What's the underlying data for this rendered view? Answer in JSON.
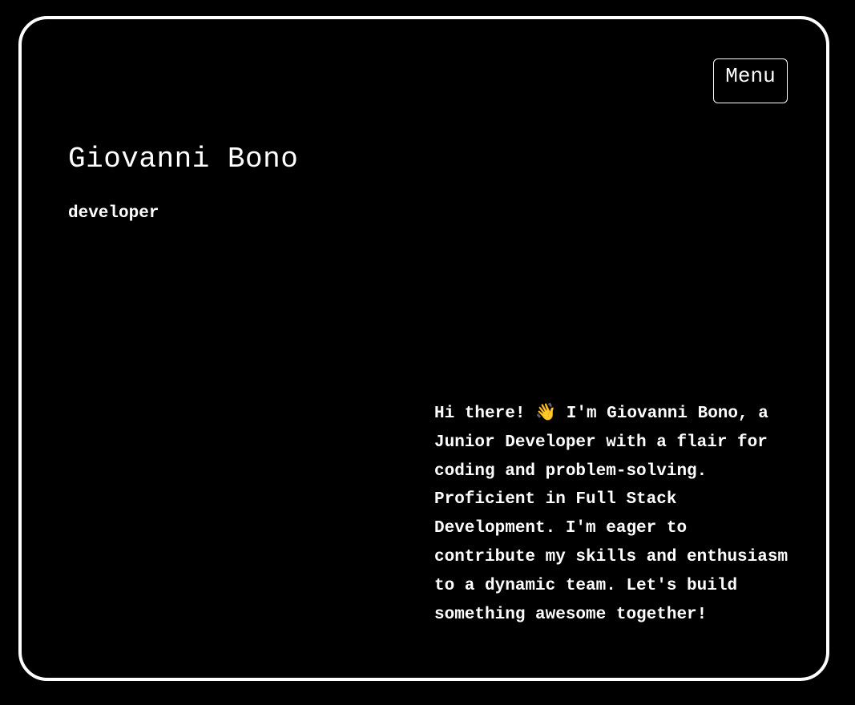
{
  "header": {
    "menu_label": "Menu"
  },
  "hero": {
    "name": "Giovanni Bono",
    "role": "developer"
  },
  "about": {
    "bio": "Hi there! 👋 I'm Giovanni Bono, a Junior Developer with a flair for coding and problem-solving. Proficient in Full Stack Development. I'm eager to contribute my skills and enthusiasm to a dynamic team. Let's build something awesome together!"
  },
  "colors": {
    "background": "#000000",
    "foreground": "#ffffff"
  }
}
